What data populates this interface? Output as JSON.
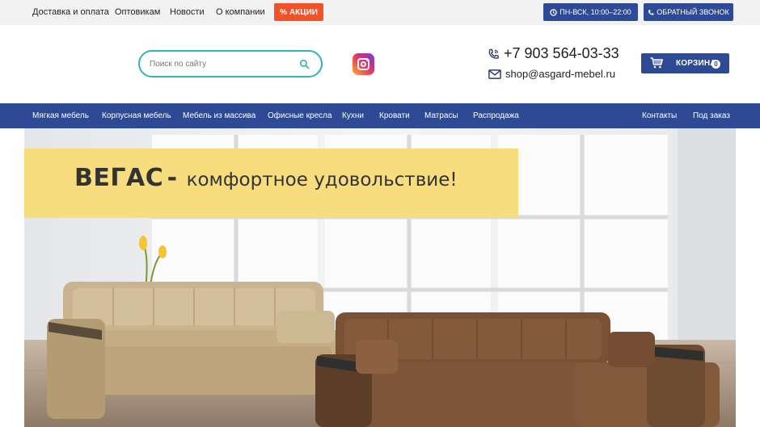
{
  "topbar": {
    "links": [
      "Доставка и оплата",
      "Оптовикам",
      "Новости",
      "О компании"
    ],
    "sale_label": "АКЦИИ",
    "hours_label": "ПН-ВСК, 10:00–22:00",
    "callback_label": "ОБРАТНЫЙ ЗВОНОК"
  },
  "header": {
    "search": {
      "placeholder": "Поиск по сайту",
      "value": ""
    },
    "phone": "+7 903 564-03-33",
    "email": "shop@asgard-mebel.ru",
    "cart": {
      "label": "КОРЗИНА",
      "count": "0"
    }
  },
  "nav": {
    "items": [
      "Мягкая мебель",
      "Корпусная мебель",
      "Мебель из массива",
      "Офисные кресла",
      "Кухни",
      "Кровати",
      "Матрасы",
      "Распродажа"
    ],
    "right_items": [
      "Контакты",
      "Под заказ"
    ]
  },
  "banner": {
    "title": "ВЕГАС",
    "subtitle": "комфортное удовольствие!"
  },
  "colors": {
    "brand_navy": "#2f4a95",
    "sale_orange": "#f0522a",
    "search_teal": "#35b3b0",
    "promo_yellow": "#f7dd7e"
  },
  "icons": [
    "percent-icon",
    "clock-icon",
    "phone-icon",
    "search-icon",
    "instagram-icon",
    "mail-icon",
    "cart-icon"
  ]
}
